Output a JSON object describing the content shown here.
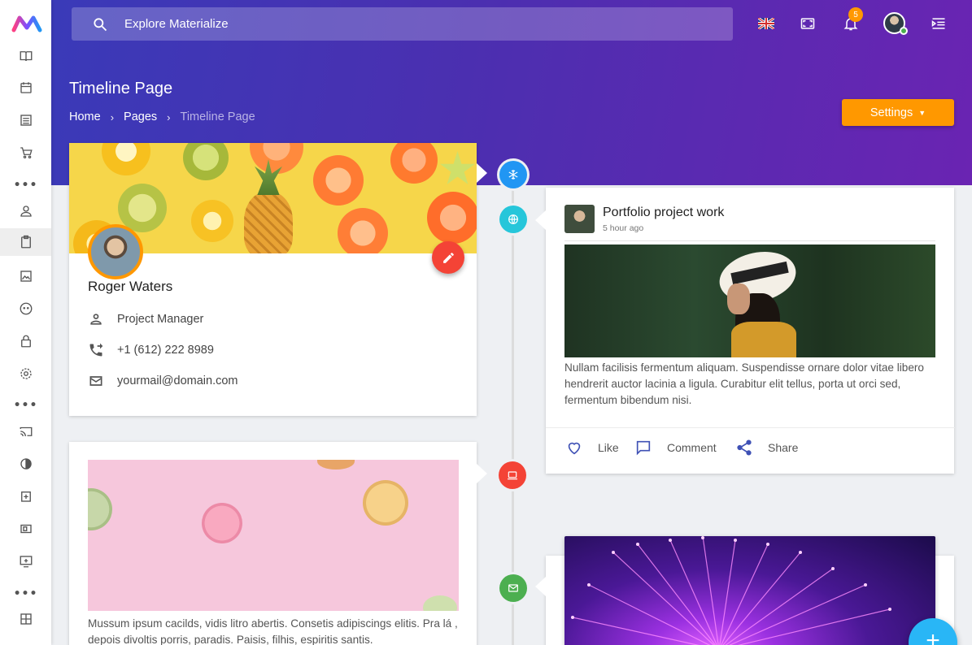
{
  "search": {
    "placeholder": "Explore Materialize"
  },
  "header": {
    "notification_count": "5"
  },
  "page": {
    "title": "Timeline Page",
    "breadcrumb": [
      "Home",
      "Pages",
      "Timeline Page"
    ],
    "settings_label": "Settings"
  },
  "profile": {
    "name": "Roger Waters",
    "role": "Project Manager",
    "phone": "+1 (612) 222 8989",
    "email": "yourmail@domain.com"
  },
  "post": {
    "title": "Portfolio project work",
    "time": "5 hour ago",
    "text": "Nullam facilisis fermentum aliquam. Suspendisse ornare dolor vitae libero hendrerit auctor lacinia a ligula. Curabitur elit tellus, porta ut orci sed, fermentum bibendum nisi.",
    "actions": {
      "like": "Like",
      "comment": "Comment",
      "share": "Share"
    }
  },
  "macaron_post": {
    "text": "Mussum ipsum cacilds, vidis litro abertis. Consetis adipiscings elitis. Pra lá , depois divoltis porris, paradis. Paisis, filhis, espiritis santis."
  },
  "colors": {
    "accent": "#ff9800",
    "header_start": "#3a3ab8",
    "header_end": "#6a24b2",
    "timeline_blue": "#2196f3",
    "timeline_cyan": "#26c6da",
    "timeline_red": "#f44336",
    "timeline_green": "#4caf50",
    "fab": "#29b6f6"
  }
}
